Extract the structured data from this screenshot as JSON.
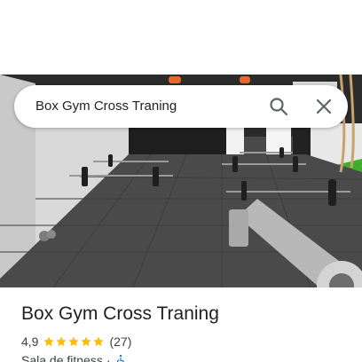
{
  "search": {
    "query": "Box Gym Cross Traning"
  },
  "place": {
    "name": "Box Gym Cross Traning",
    "rating": "4,9",
    "stars": 5,
    "review_count": "(27)",
    "category": "Sala de fitness",
    "separator": "·",
    "accessibility_icon": "wheelchair-icon"
  },
  "icons": {
    "search": "search-icon",
    "close": "close-icon",
    "star": "star-icon"
  },
  "colors": {
    "star": "#fbbc04",
    "accessibility": "#1a73e8",
    "search_icon": "#5f6368",
    "text_primary": "#202124",
    "text_secondary": "#3c4043"
  }
}
